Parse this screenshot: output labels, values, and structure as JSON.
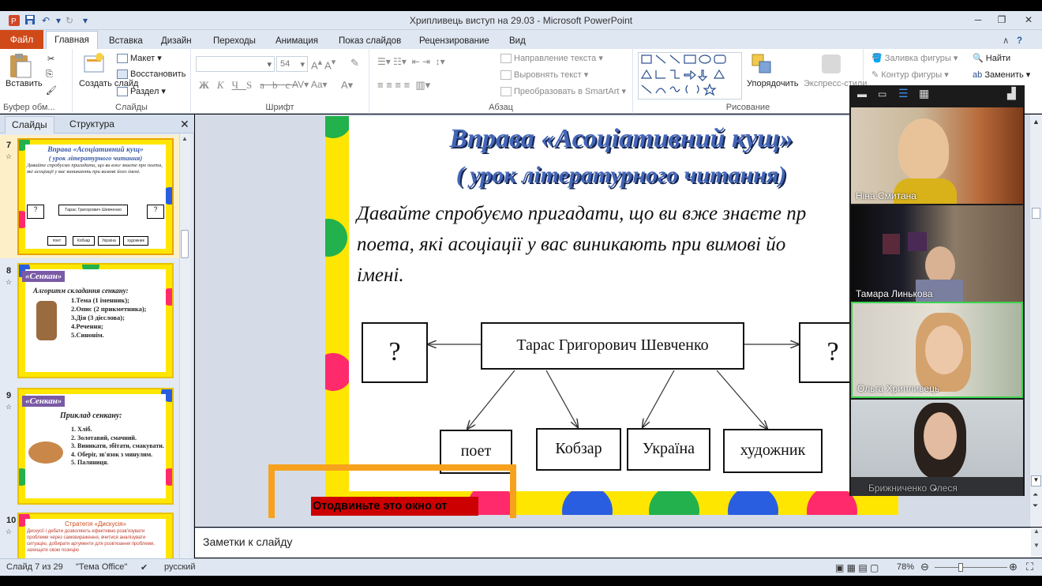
{
  "window": {
    "title": "Хрипливець виступ на 29.03 - Microsoft PowerPoint"
  },
  "tabs": [
    "Файл",
    "Главная",
    "Вставка",
    "Дизайн",
    "Переходы",
    "Анимация",
    "Показ слайдов",
    "Рецензирование",
    "Вид"
  ],
  "ribbon": {
    "clipboard": {
      "label": "Буфер обм...",
      "paste": "Вставить"
    },
    "slides": {
      "label": "Слайды",
      "new_slide": "Создать слайд",
      "layout": "Макет",
      "reset": "Восстановить",
      "section": "Раздел"
    },
    "font": {
      "label": "Шрифт",
      "size": "54"
    },
    "paragraph": {
      "label": "Абзац",
      "text_direction": "Направление текста",
      "align_text": "Выровнять текст",
      "smartart": "Преобразовать в SmartArt"
    },
    "drawing": {
      "label": "Рисование",
      "arrange": "Упорядочить",
      "quick_styles": "Экспресс-стили",
      "shape_fill": "Заливка фигуры",
      "shape_outline": "Контур фигуры"
    },
    "editing": {
      "find": "Найти",
      "replace": "Заменить"
    }
  },
  "pane": {
    "tab_slides": "Слайды",
    "tab_outline": "Структура"
  },
  "thumbnails": [
    {
      "num": "7",
      "title": "Вправа «Асоціативний кущ»",
      "subtitle": "( урок літературного читання)",
      "text": "Давайте спробуємо пригадати, що ви вже знаєте про поета, які асоціації у вас виникають при вимові його імені.",
      "center": "Тарас Григорович Шевченко",
      "q": "?",
      "items": [
        "поет",
        "Кобзар",
        "Україна",
        "художник"
      ]
    },
    {
      "num": "8",
      "badge": "«Сенкан»",
      "heading": "Алгоритм складання сенкану:",
      "lines": [
        "1.Тема (1 іменник);",
        "2.Опис (2 прикметника);",
        "3.Дія (3 дієслова);",
        "4.Речення;",
        "5.Синонім."
      ]
    },
    {
      "num": "9",
      "badge": "«Сенкан»",
      "heading": "Приклад сенкану:",
      "lines": [
        "1. Хліб.",
        "2. Золотавий, смачний.",
        "3. Виникати, збітати, смакувати.",
        "4. Оберіг, зв'язок з минулим.",
        "5. Паляниця."
      ]
    },
    {
      "num": "10",
      "heading": "Стратегія «Дискусія»",
      "text": "Дискусії і дебати дозволяють ефективно розв'язувати проблеми через самовираження, вчитися аналізувати ситуацію, добирати аргументи для розв'язання проблеми, захищати свою позицію"
    }
  ],
  "slide": {
    "title": "Вправа «Асоціативний кущ»",
    "subtitle": "( урок літературного читання)",
    "body_lines": [
      "Давайте спробуємо пригадати, що ви вже знаєте пр",
      "поета, які асоціації у вас виникають при вимові йо",
      "імені."
    ],
    "center": "Тарас Григорович Шевченко",
    "q_left": "?",
    "q_right": "?",
    "items": [
      "поет",
      "Кобзар",
      "Україна",
      "художник"
    ]
  },
  "overlay": {
    "text": "Отодвиньте это окно от"
  },
  "notes": {
    "placeholder": "Заметки к слайду"
  },
  "status": {
    "slide": "Слайд 7 из 29",
    "theme": "\"Тема Office\"",
    "lang": "русский",
    "zoom": "78%"
  },
  "participants": [
    "Ніна Смитана",
    "Тамара Линькова",
    "Ольга Хрипливець",
    "Брижниченко Олеся"
  ]
}
